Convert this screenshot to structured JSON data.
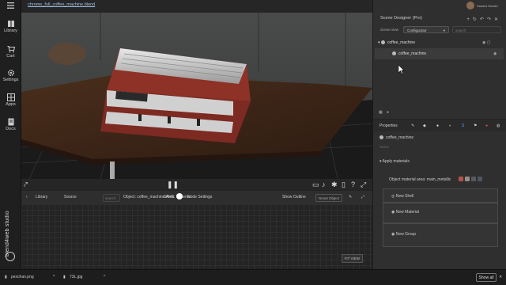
{
  "sidebar": {
    "items": [
      {
        "label": "Library",
        "icon": "library-icon"
      },
      {
        "label": "Cart",
        "icon": "cart-icon"
      },
      {
        "label": "Settings",
        "icon": "gear-icon"
      },
      {
        "label": "Apps",
        "icon": "apps-grid-icon"
      },
      {
        "label": "Docs",
        "icon": "docs-icon"
      }
    ],
    "brand": "blend4web studio"
  },
  "file_tab": {
    "label": "chrome_full_coffee_machine.blend"
  },
  "viewport": {
    "description_colors": {
      "wall": "#3f4040",
      "table": "#3b2618",
      "floor": "#1d1d1d",
      "machine_body": "#7c2a22"
    }
  },
  "library_bar": {
    "library_label": "Library",
    "source_label": "Source",
    "search_placeholder": "search",
    "object_text": "Object: coffee_machine  Area: Material",
    "save_label": "SAVE",
    "node_settings_label": "Node Settings",
    "show_outline_label": "Show Outline",
    "reset_label": "Reset Object",
    "fit_view_label": "FIT VIEW"
  },
  "panel": {
    "title": "Scene Designer (Pro)",
    "profile_name": "Sandra Hiroshi",
    "scene_label": "Scene view",
    "scene_select": "Configurator",
    "search_placeholder": "search",
    "tree": {
      "parent": "coffee_machine",
      "child": "coffee_machine"
    },
    "props_tab_label": "Properties",
    "object_name": "coffee_machine",
    "name_placeholder": "Name",
    "apply_materials_label": "Apply materials",
    "material_row_label": "Object material area: main_metallic",
    "swatches": [
      "#b5524a",
      "#9a8c8a",
      "#555a60",
      "#4d5560"
    ],
    "cards": [
      {
        "label": "New Shell"
      },
      {
        "label": "New Material"
      },
      {
        "label": "New Group"
      }
    ]
  },
  "bottom_bar": {
    "downloads": [
      "pexchan.png",
      "73L.jpg"
    ],
    "show_all_label": "Show all"
  }
}
